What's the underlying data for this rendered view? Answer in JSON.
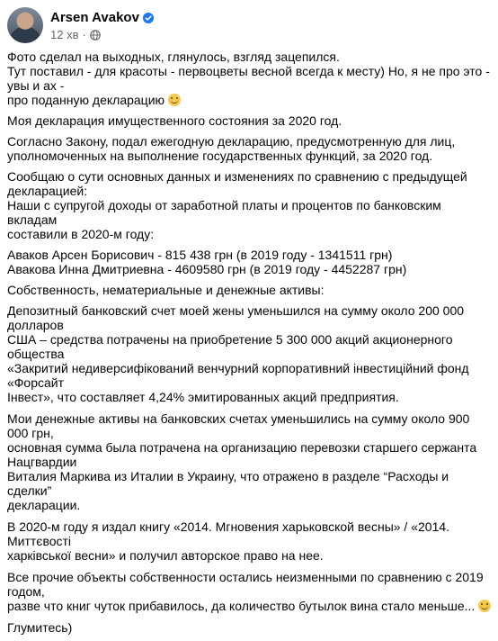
{
  "author": {
    "name": "Arsen Avakov",
    "verified_icon": "verified-badge-icon",
    "time": "12 хв",
    "separator": "·",
    "audience_icon": "globe-icon"
  },
  "colors": {
    "text": "#050505",
    "secondary": "#65676b",
    "verified": "#1877f2"
  },
  "post": {
    "p1_l1": "Фото сделал на выходных, глянулось, взгляд зацепился.",
    "p1_l2": "Тут поставил - для красоты - первоцветы весной всегда к месту) Но, я не про это - увы и ах -",
    "p1_l3": "про поданную декларацию",
    "p2": "Моя декларация имущественного состояния за 2020 год.",
    "p3_l1": "Согласно Закону, подал ежегодную декларацию, предусмотренную для лиц,",
    "p3_l2": "уполномоченных на выполнение государственных функций, за 2020 год.",
    "p4_l1": " Сообщаю о сути основных данных и изменениях по сравнению с предыдущей декларацией:",
    "p4_l2": " Наши с супругой доходы от заработной платы и процентов по банковским вкладам",
    "p4_l3": " составили в 2020-м году:",
    "p5_l1": "Аваков Арсен Борисович - 815 438 грн (в 2019 году - 1341511 грн)",
    "p5_l2": "Авакова Инна Дмитриевна - 4609580 грн (в 2019 году - 4452287 грн)",
    "p6": "Собственность, нематериальные и денежные активы:",
    "p7_l1": "Депозитный банковский счет моей жены уменьшился на сумму около 200 000 долларов",
    "p7_l2": "США – средства потрачены на приобретение 5 300 000 акций акционерного общества",
    "p7_l3": "«Закритий недиверсифікований венчурний корпоративний інвестиційний фонд «Форсайт",
    "p7_l4": "Інвест», что составляет 4,24% эмитированных акций предприятия.",
    "p8_l1": "Мои денежные активы на банковских счетах уменьшились на сумму около 900 000 грн,",
    "p8_l2": "основная сумма была потрачена на организацию перевозки старшего сержанта Нацгвардии",
    "p8_l3": "Виталия Маркива из Италии в Украину, что отражено в разделе “Расходы и сделки”",
    "p8_l4": "декларации.",
    "p9_l1": "В 2020-м году я издал книгу «2014. Мгновения харьковской весны»  /   «2014. Миттєвості",
    "p9_l2": "харківської весни» и получил авторское право на нее.",
    "p10_l1": "Все прочие объекты собственности остались неизменными по сравнению с 2019 годом,",
    "p10_l2": "разве что книг чуток прибавилось, да количество бутылок вина стало меньше...",
    "p11": "Глумитесь)",
    "emoji_icon": "smiling-face-emoji"
  }
}
